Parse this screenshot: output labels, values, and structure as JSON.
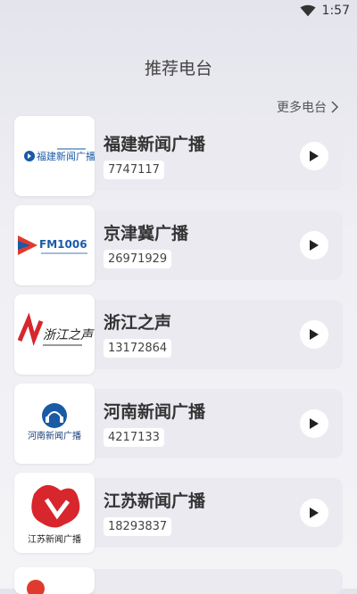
{
  "status_bar": {
    "time": "1:57"
  },
  "header": {
    "title": "推荐电台"
  },
  "more": {
    "label": "更多电台"
  },
  "stations": [
    {
      "name": "福建新闻广播",
      "count": "7747117",
      "logo_text": "福建新闻广播"
    },
    {
      "name": "京津冀广播",
      "count": "26971929",
      "logo_text": "FM1006"
    },
    {
      "name": "浙江之声",
      "count": "13172864",
      "logo_text": "浙江之声"
    },
    {
      "name": "河南新闻广播",
      "count": "4217133",
      "logo_text": "河南新闻广播"
    },
    {
      "name": "江苏新闻广播",
      "count": "18293837",
      "logo_text": "江苏新闻广播"
    }
  ],
  "colors": {
    "accent_red": "#d7262c",
    "accent_blue": "#1a5aa6"
  }
}
